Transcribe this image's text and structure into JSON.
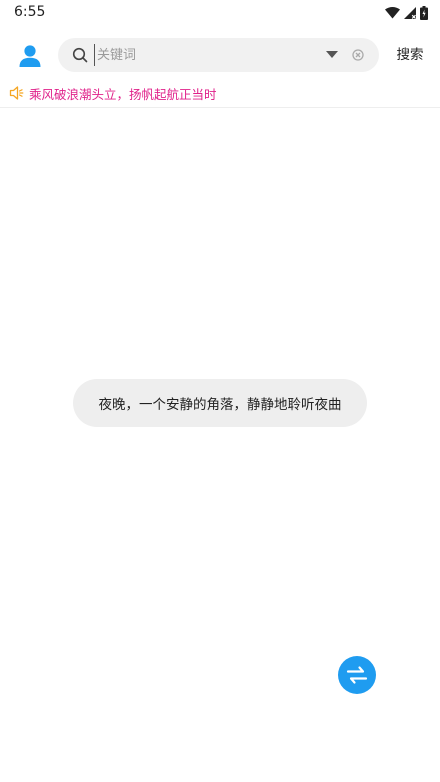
{
  "status_bar": {
    "time": "6:55",
    "icons": [
      "wifi-icon",
      "signal-icon",
      "battery-icon"
    ]
  },
  "header": {
    "avatar_icon": "user-icon",
    "search": {
      "placeholder": "关键词",
      "value": ""
    },
    "search_button_label": "搜索"
  },
  "notice": {
    "icon": "speaker-icon",
    "text": "乘风破浪潮头立，扬帆起航正当时",
    "color": "#e0218a"
  },
  "toast": {
    "text": "夜晚，一个安静的角落，静静地聆听夜曲"
  },
  "fab": {
    "icon": "swap-arrows-icon",
    "color": "#1f9cf0"
  },
  "colors": {
    "accent": "#1f9cf0",
    "notice_icon": "#f5a623"
  }
}
